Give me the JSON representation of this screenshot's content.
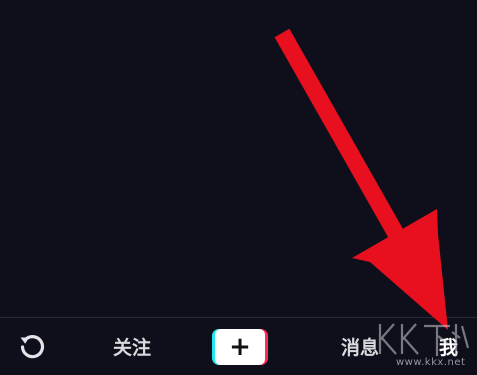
{
  "bottom_nav": {
    "refresh_icon": "refresh-icon",
    "follow_label": "关注",
    "create_icon": "plus-icon",
    "create_label": "+",
    "messages_label": "消息",
    "me_label": "我"
  },
  "watermark": {
    "logo_text": "KK下载",
    "url": "www.kkx.net"
  },
  "annotation": {
    "arrow_color": "#e8101e",
    "arrow_target": "bottom_nav.me_label"
  },
  "colors": {
    "background": "#0f0f1b",
    "nav_text": "#d9d9de",
    "create_cyan": "#24e6ee",
    "create_red": "#fd2c55"
  }
}
